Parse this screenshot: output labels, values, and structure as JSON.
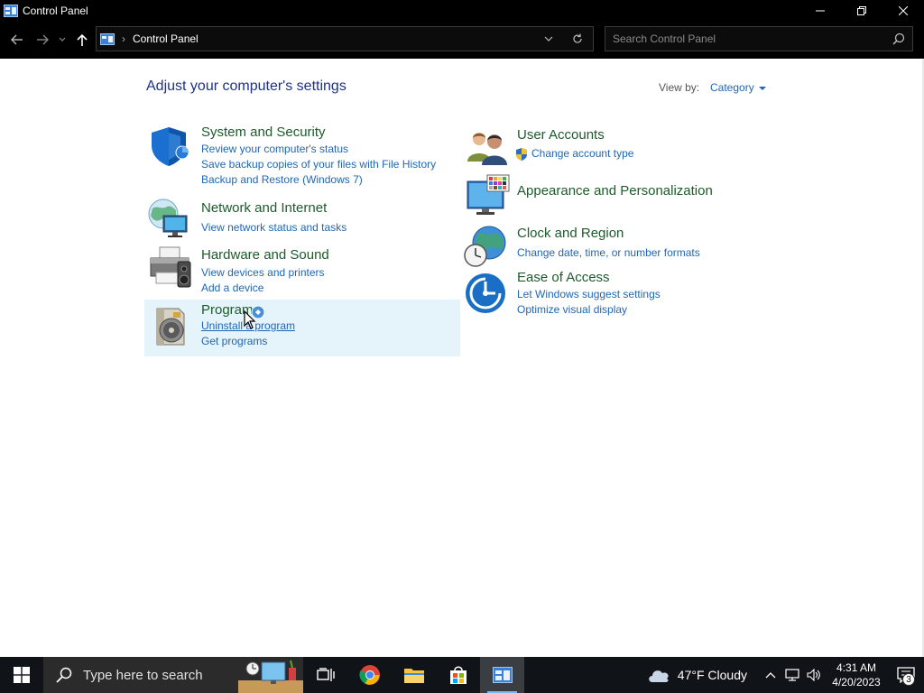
{
  "window": {
    "title": "Control Panel"
  },
  "address": {
    "path_item": "Control Panel",
    "separator": "›"
  },
  "search": {
    "placeholder": "Search Control Panel"
  },
  "page": {
    "heading": "Adjust your computer's settings",
    "view_by_label": "View by:",
    "view_by_value": "Category"
  },
  "categories": [
    {
      "title": "System and Security",
      "icon": "shield-icon",
      "links": [
        "Review your computer's status",
        "Save backup copies of your files with File History",
        "Backup and Restore (Windows 7)"
      ]
    },
    {
      "title": "Network and Internet",
      "icon": "network-globe-icon",
      "links": [
        "View network status and tasks"
      ]
    },
    {
      "title": "Hardware and Sound",
      "icon": "printer-speaker-icon",
      "links": [
        "View devices and printers",
        "Add a device"
      ]
    },
    {
      "title": "Programs",
      "icon": "programs-disc-icon",
      "links": [
        "Uninstall a program",
        "Get programs"
      ]
    },
    {
      "title": "User Accounts",
      "icon": "users-icon",
      "links": [
        "Change account type"
      ]
    },
    {
      "title": "Appearance and Personalization",
      "icon": "monitor-palette-icon",
      "links": []
    },
    {
      "title": "Clock and Region",
      "icon": "clock-globe-icon",
      "links": [
        "Change date, time, or number formats"
      ]
    },
    {
      "title": "Ease of Access",
      "icon": "ease-of-access-icon",
      "links": [
        "Let Windows suggest settings",
        "Optimize visual display"
      ]
    }
  ],
  "taskbar": {
    "search_placeholder": "Type here to search",
    "apps": [
      "task-view-icon",
      "chrome-icon",
      "file-explorer-icon",
      "store-icon",
      "control-panel-icon"
    ],
    "weather_text": "47°F  Cloudy",
    "time": "4:31 AM",
    "date": "4/20/2023",
    "notification_count": "3"
  },
  "colors": {
    "category_title": "#1e5a2c",
    "link": "#1f66b5",
    "heading": "#1e3287",
    "hover_background": "#e5f3fb"
  }
}
